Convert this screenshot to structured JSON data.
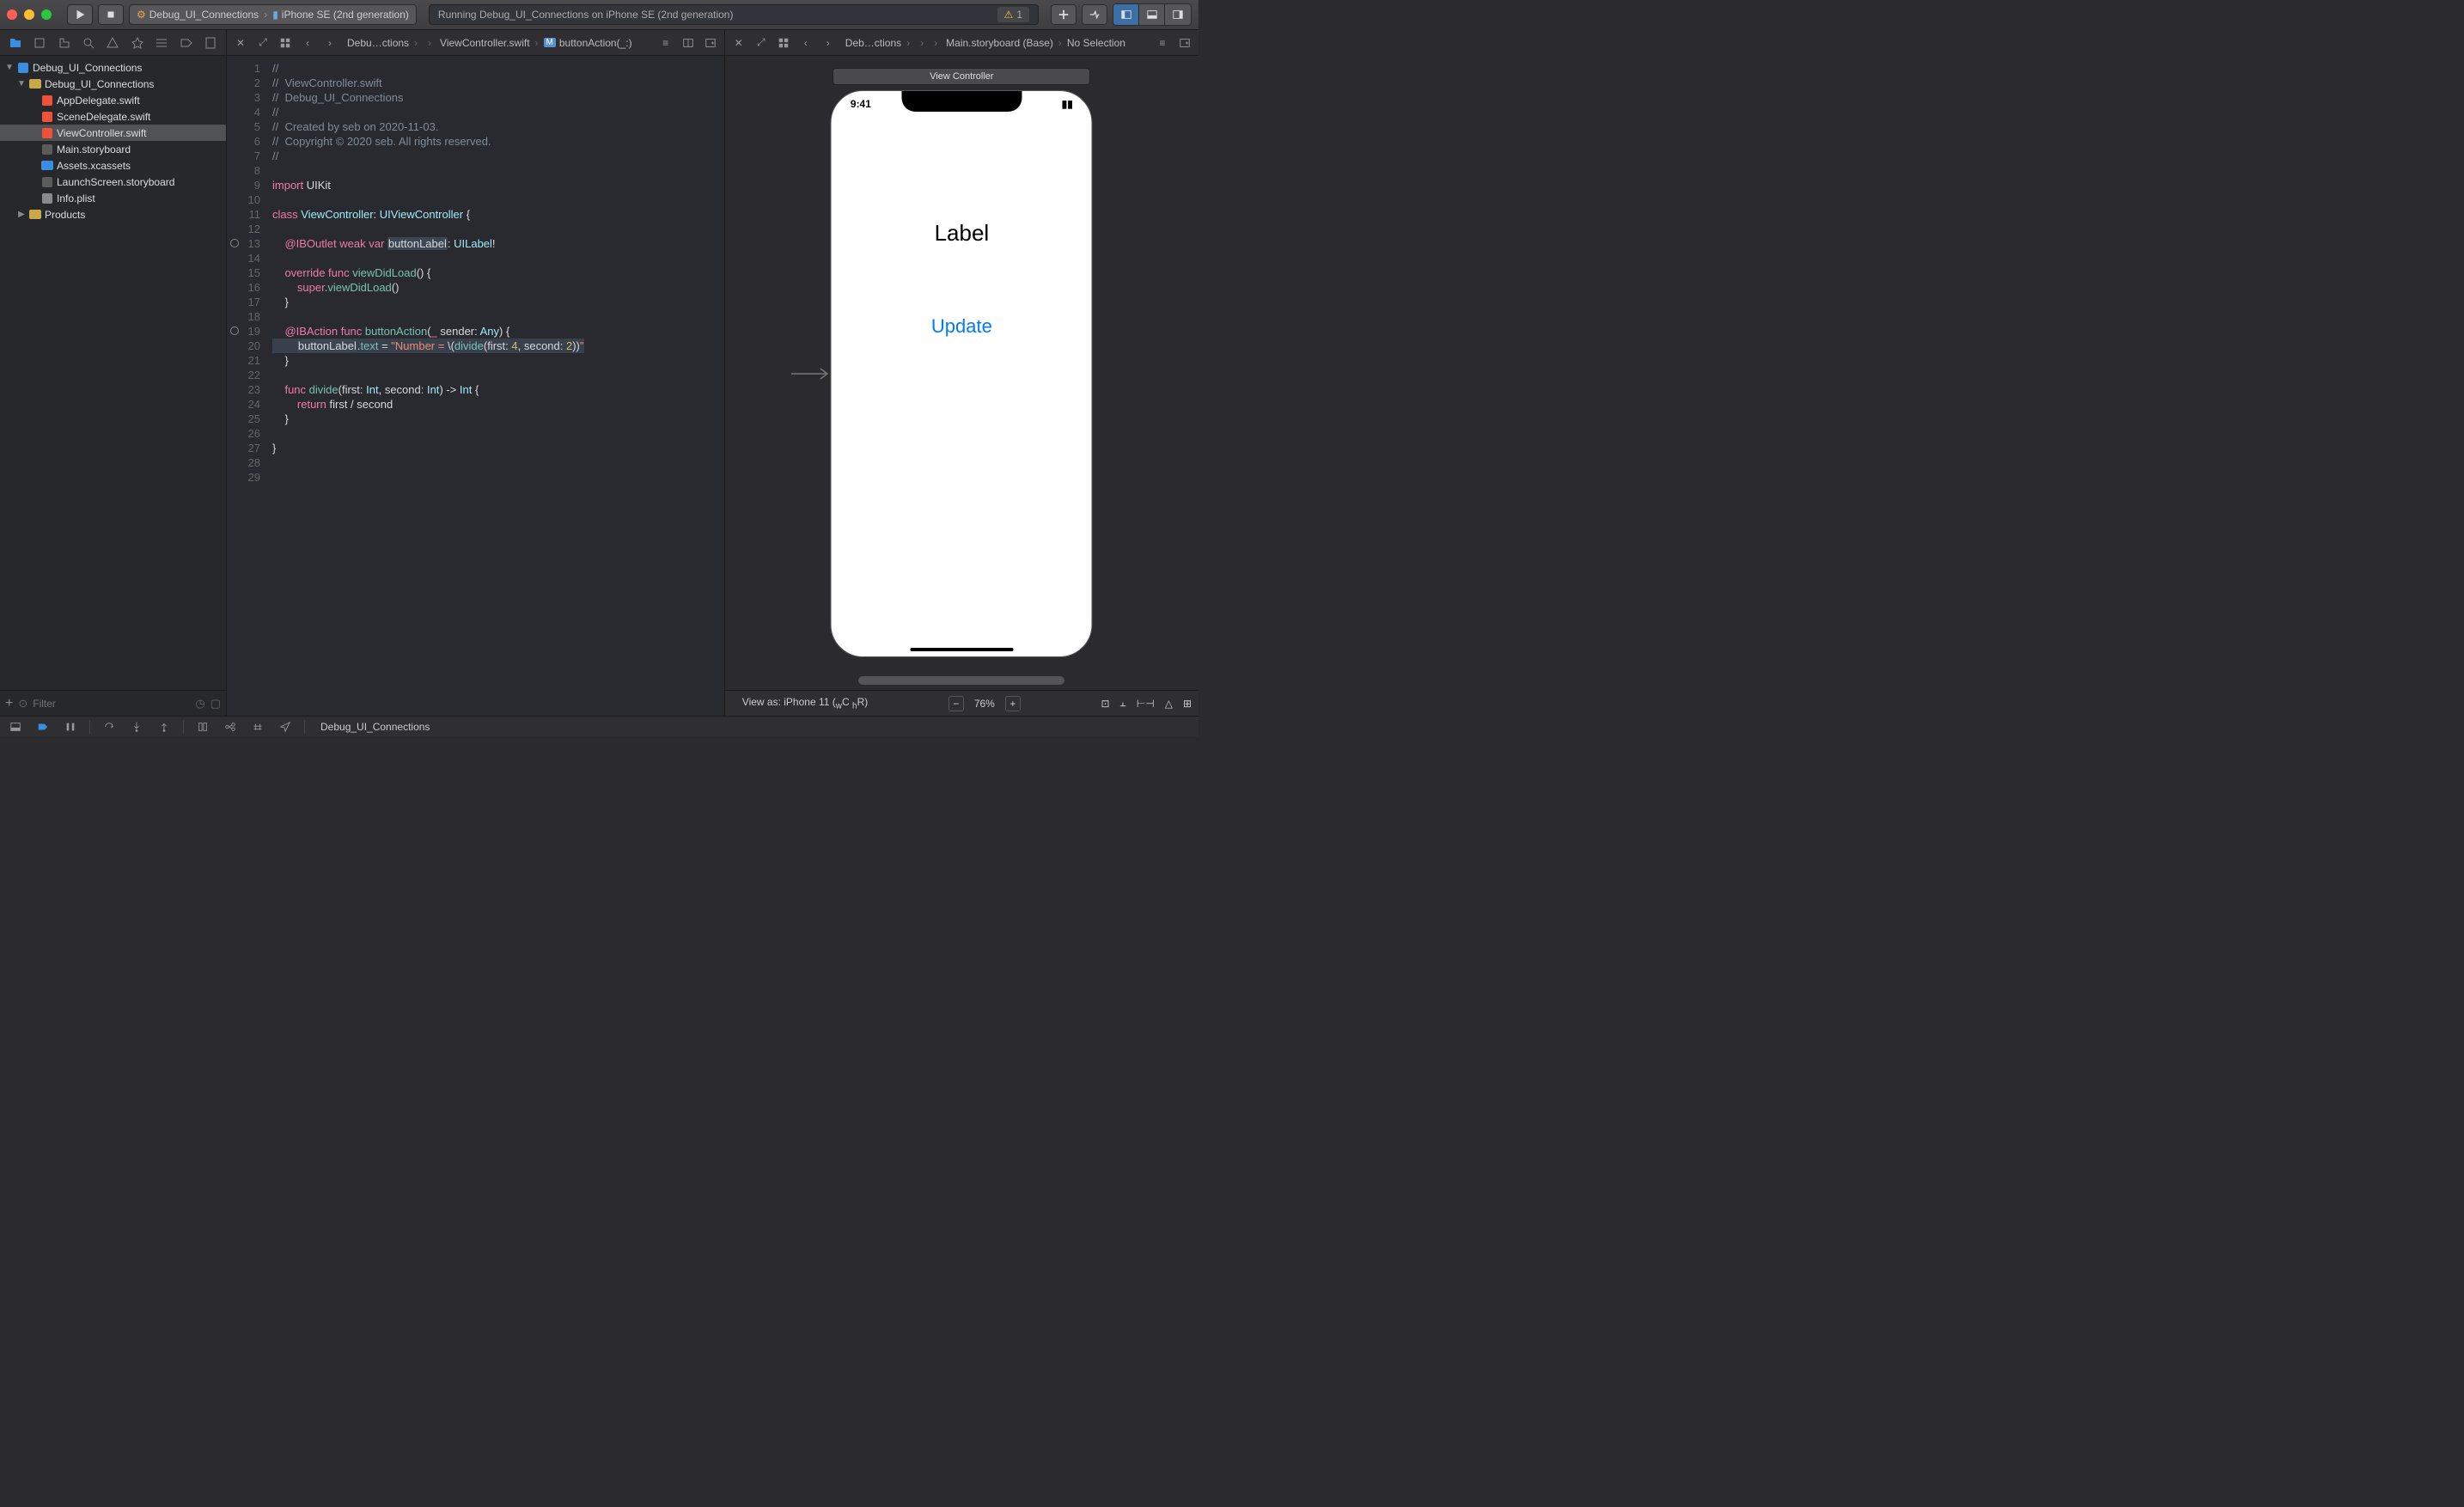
{
  "toolbar": {
    "scheme_target": "Debug_UI_Connections",
    "scheme_device": "iPhone SE (2nd generation)",
    "status_text": "Running Debug_UI_Connections on iPhone SE (2nd generation)",
    "warning_count": "1"
  },
  "navigator": {
    "project": "Debug_UI_Connections",
    "group": "Debug_UI_Connections",
    "files": [
      "AppDelegate.swift",
      "SceneDelegate.swift",
      "ViewController.swift",
      "Main.storyboard",
      "Assets.xcassets",
      "LaunchScreen.storyboard",
      "Info.plist"
    ],
    "products": "Products",
    "filter_placeholder": "Filter",
    "add_label": "+"
  },
  "jumpbar_left": {
    "file": "Debu…ctions",
    "group": "ViewController.swift",
    "symbol": "buttonAction(_:)"
  },
  "jumpbar_right": {
    "file": "Deb…ctions",
    "doc": "Main.storyboard (Base)",
    "sel": "No Selection"
  },
  "code": {
    "lines": [
      {
        "n": 1,
        "t": "//",
        "cls": "cmt"
      },
      {
        "n": 2,
        "t": "//  ViewController.swift",
        "cls": "cmt"
      },
      {
        "n": 3,
        "t": "//  Debug_UI_Connections",
        "cls": "cmt"
      },
      {
        "n": 4,
        "t": "//",
        "cls": "cmt"
      },
      {
        "n": 5,
        "t": "//  Created by seb on 2020-11-03.",
        "cls": "cmt"
      },
      {
        "n": 6,
        "t": "//  Copyright © 2020 seb. All rights reserved.",
        "cls": "cmt"
      },
      {
        "n": 7,
        "t": "//",
        "cls": "cmt"
      },
      {
        "n": 8,
        "t": ""
      },
      {
        "n": 9,
        "html": "<span class='kw'>import</span> UIKit"
      },
      {
        "n": 10,
        "t": ""
      },
      {
        "n": 11,
        "html": "<span class='kw'>class</span> <span class='typ'>ViewController</span>: <span class='typ'>UIViewController</span> {"
      },
      {
        "n": 12,
        "t": ""
      },
      {
        "n": 13,
        "bp": true,
        "html": "    <span class='attr'>@IBOutlet</span> <span class='kw'>weak</span> <span class='kw'>var</span> <span class='hl'>buttonLabel</span>: <span class='typ'>UILabel</span>!"
      },
      {
        "n": 14,
        "t": ""
      },
      {
        "n": 15,
        "html": "    <span class='kw'>override</span> <span class='kw'>func</span> <span class='fn'>viewDidLoad</span>() {"
      },
      {
        "n": 16,
        "html": "        <span class='kw'>super</span>.<span class='id'>viewDidLoad</span>()"
      },
      {
        "n": 17,
        "t": "    }"
      },
      {
        "n": 18,
        "t": ""
      },
      {
        "n": 19,
        "bp": true,
        "html": "    <span class='attr'>@IBAction</span> <span class='kw'>func</span> <span class='fn'>buttonAction</span>(<span class='kw'>_</span> sender: <span class='typ'>Any</span>) {"
      },
      {
        "n": 20,
        "cur": true,
        "html": "        <span class='hl'>buttonLabel</span>.<span class='id'>text</span> = <span class='str'>\"Number = </span>\\(<span class='id'>divide</span>(first: <span class='num'>4</span>, second: <span class='num'>2</span>))<span class='str'>\"</span>"
      },
      {
        "n": 21,
        "t": "    }"
      },
      {
        "n": 22,
        "t": ""
      },
      {
        "n": 23,
        "html": "    <span class='kw'>func</span> <span class='fn'>divide</span>(first: <span class='typ'>Int</span>, second: <span class='typ'>Int</span>) -> <span class='typ'>Int</span> {"
      },
      {
        "n": 24,
        "html": "        <span class='kw'>return</span> first / second"
      },
      {
        "n": 25,
        "t": "    }"
      },
      {
        "n": 26,
        "t": ""
      },
      {
        "n": 27,
        "t": "}"
      },
      {
        "n": 28,
        "t": ""
      },
      {
        "n": 29,
        "t": ""
      }
    ]
  },
  "ib": {
    "header": "View Controller",
    "time": "9:41",
    "label_text": "Label",
    "button_text": "Update",
    "viewas": "View as: iPhone 11 (",
    "viewas2": "C",
    "viewas3": "R)",
    "zoom": "76%"
  },
  "debug": {
    "target": "Debug_UI_Connections"
  }
}
